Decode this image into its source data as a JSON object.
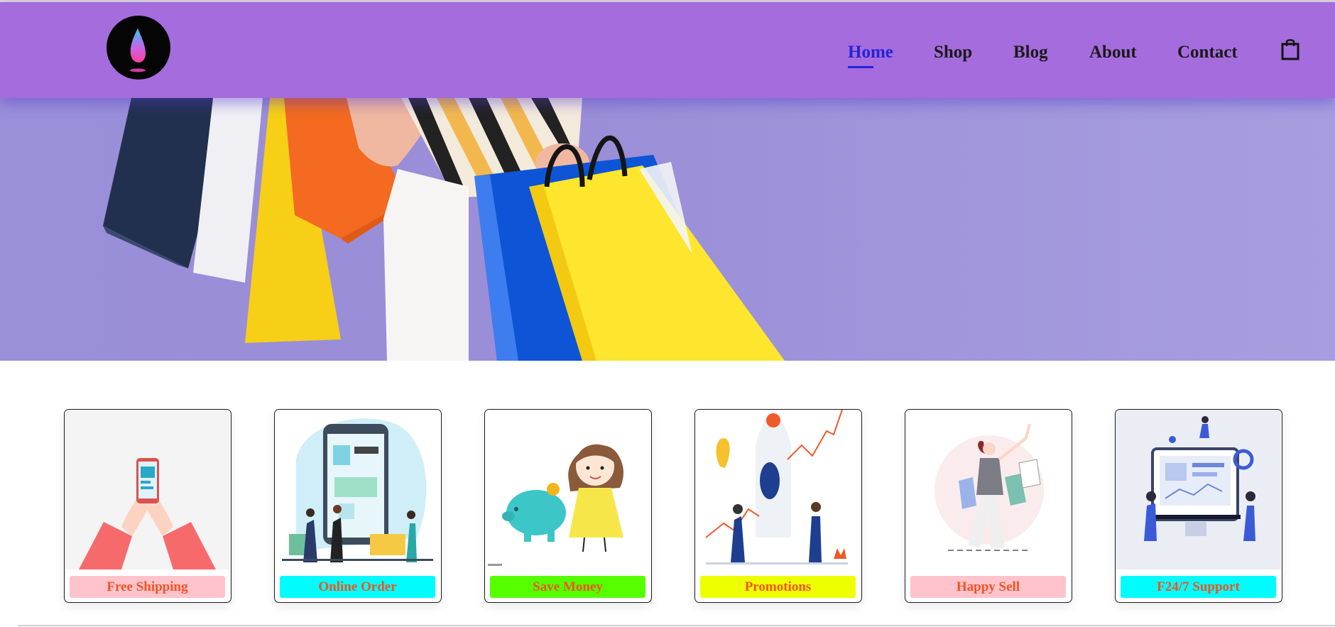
{
  "colors": {
    "header_bg": "#a56cde",
    "nav_active": "#2424d8",
    "hero_bg": "#9a8fd9",
    "label_text": "#f25322"
  },
  "header": {
    "logo_icon": "flame-drop-logo",
    "nav": [
      {
        "label": "Home",
        "active": true
      },
      {
        "label": "Shop",
        "active": false
      },
      {
        "label": "Blog",
        "active": false
      },
      {
        "label": "About",
        "active": false
      },
      {
        "label": "Contact",
        "active": false
      }
    ],
    "cart_icon": "shopping-bag-icon"
  },
  "hero": {
    "image": "woman-holding-shopping-bags"
  },
  "features": [
    {
      "label": "Free Shipping",
      "color": "#ffc3cc",
      "image": "hands-holding-phone"
    },
    {
      "label": "Online Order",
      "color": "#00fcfc",
      "image": "people-shopping-on-phone"
    },
    {
      "label": "Save Money",
      "color": "#55ff00",
      "image": "girl-with-piggy-bank"
    },
    {
      "label": "Promotions",
      "color": "#eeff00",
      "image": "rocket-and-people"
    },
    {
      "label": "Happy Sell",
      "color": "#ffc3cc",
      "image": "woman-with-shopping-bags"
    },
    {
      "label": "F24/7 Support",
      "color": "#00fcfc",
      "image": "people-with-computer"
    }
  ]
}
